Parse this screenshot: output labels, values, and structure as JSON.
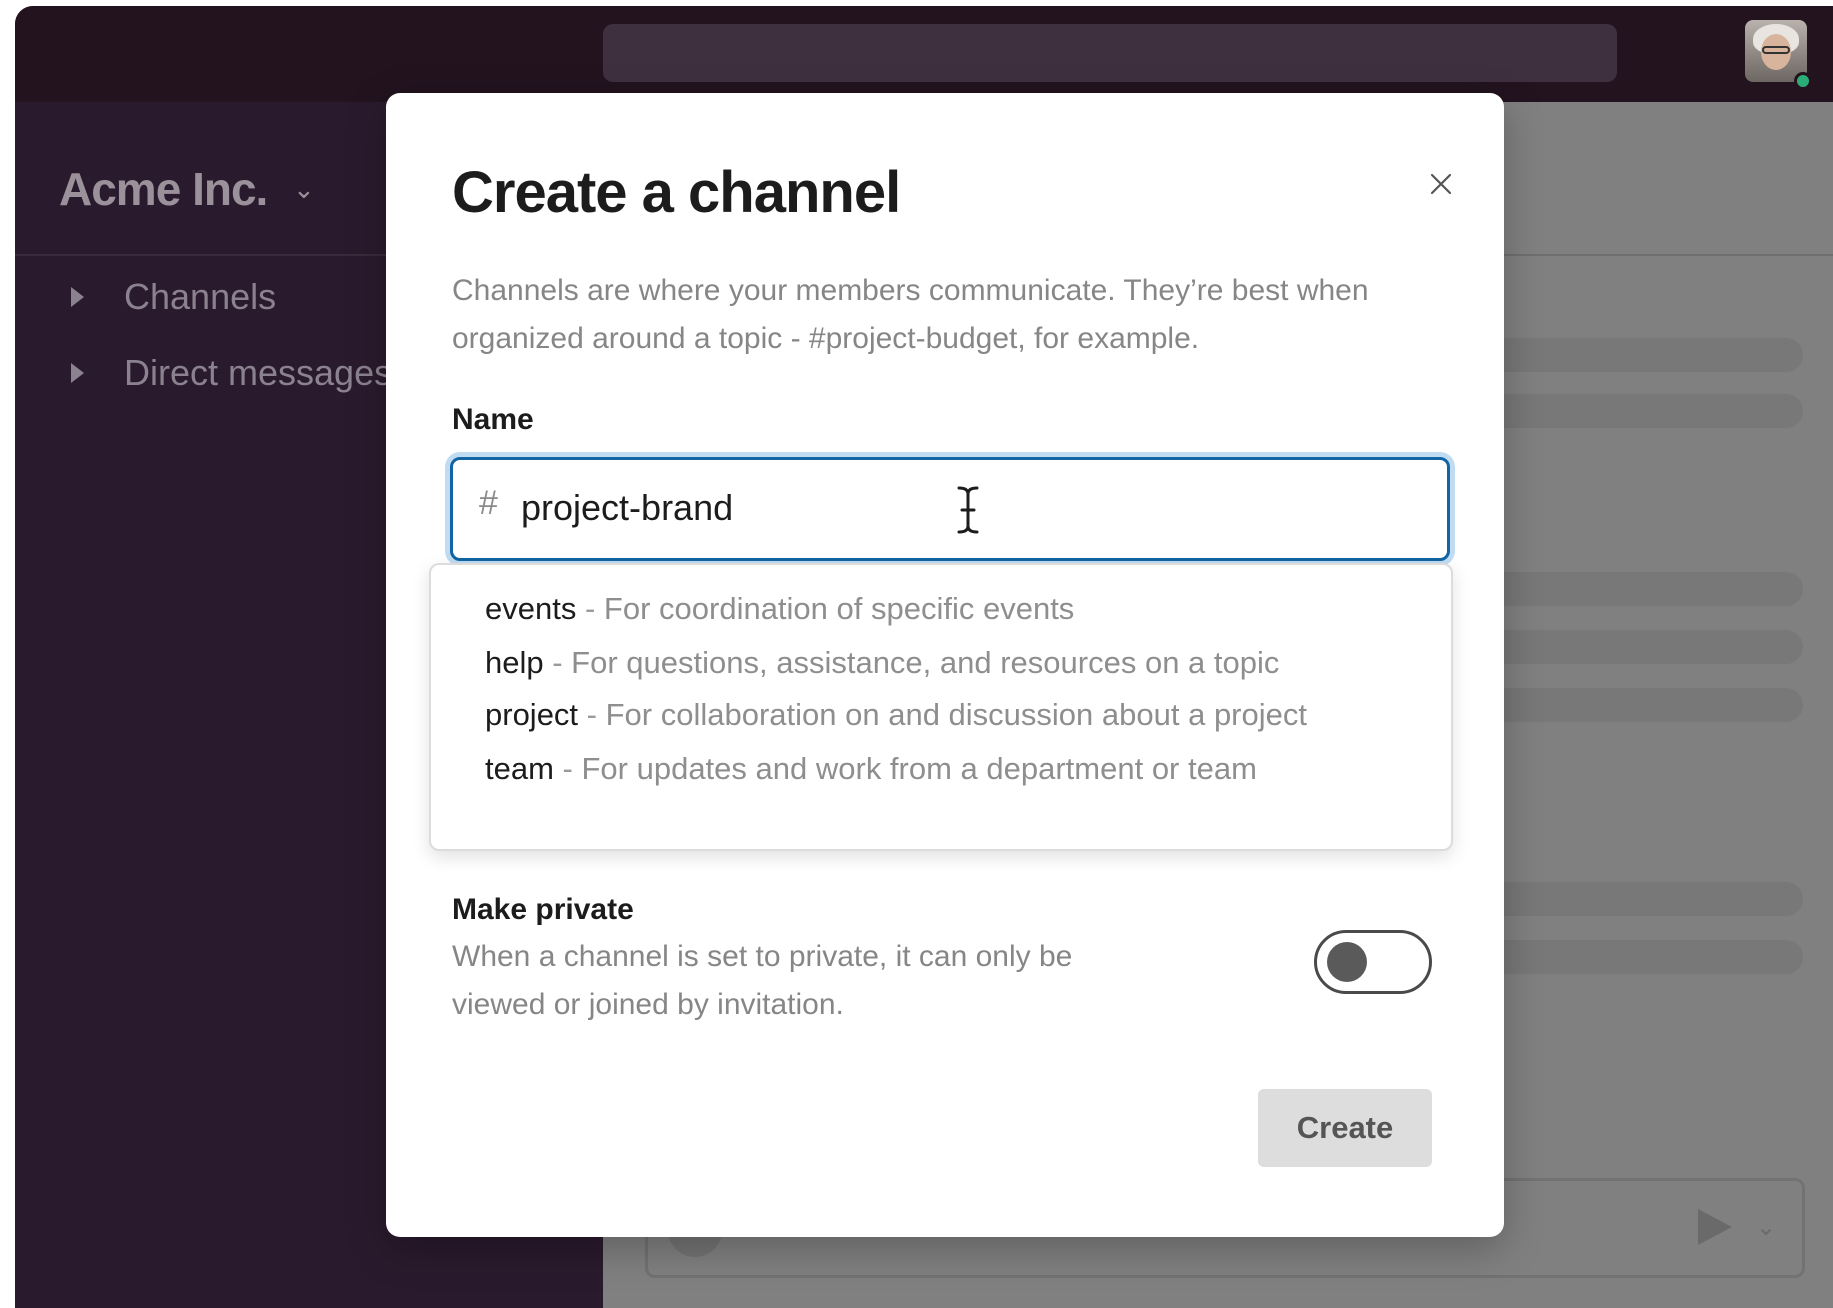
{
  "workspace": {
    "name": "Acme Inc.",
    "chevron": "⌄"
  },
  "sidebar": {
    "sections": [
      {
        "label": "Channels",
        "icon": "caret-right-icon"
      },
      {
        "label": "Direct messages",
        "icon": "caret-right-icon"
      }
    ]
  },
  "modal": {
    "title": "Create a channel",
    "description": "Channels are where your members communicate. They’re best when organized around a topic - #project-budget, for example.",
    "close_icon": "close-icon",
    "name_label": "Name",
    "name_prefix": "#",
    "name_value": "project-brand",
    "suggestions": [
      {
        "name": "events",
        "separator": " - ",
        "description": "For coordination of specific events"
      },
      {
        "name": "help",
        "separator": " - ",
        "description": "For questions, assistance, and resources on a topic"
      },
      {
        "name": "project",
        "separator": " - ",
        "description": "For collaboration on and discussion about a project"
      },
      {
        "name": "team",
        "separator": " - ",
        "description": "For updates and work from a department or team"
      }
    ],
    "private_label": "Make private",
    "private_description": "When a channel is set to private, it can only be viewed or joined by invitation.",
    "private_enabled": false,
    "create_label": "Create"
  },
  "colors": {
    "sidebar_bg": "#2a1a2d",
    "topbar_bg": "#22131f",
    "focus_border": "#1264a3",
    "status_online": "#2bac76"
  }
}
